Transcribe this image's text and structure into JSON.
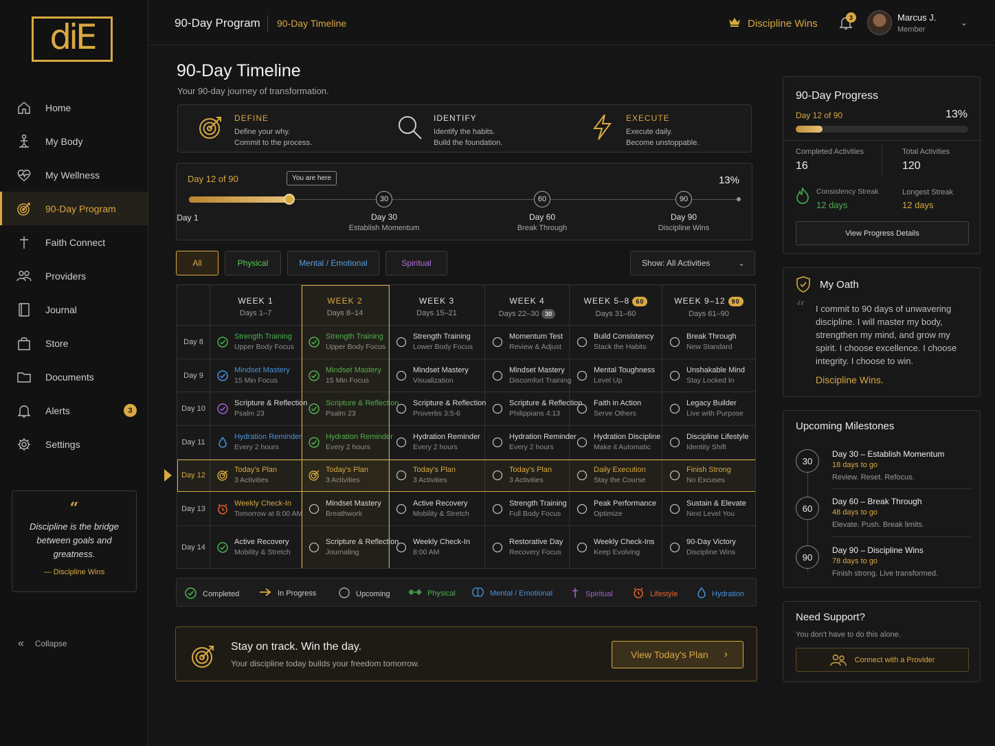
{
  "logo": {
    "text": "diE"
  },
  "sidebar": {
    "items": [
      {
        "label": "Home",
        "icon": "home-icon"
      },
      {
        "label": "My Body",
        "icon": "body-icon"
      },
      {
        "label": "My Wellness",
        "icon": "heart-pulse-icon"
      },
      {
        "label": "90-Day Program",
        "icon": "target-icon"
      },
      {
        "label": "Faith Connect",
        "icon": "cross-icon"
      },
      {
        "label": "Providers",
        "icon": "people-icon"
      },
      {
        "label": "Journal",
        "icon": "journal-icon"
      },
      {
        "label": "Store",
        "icon": "bag-icon"
      },
      {
        "label": "Documents",
        "icon": "folder-icon"
      },
      {
        "label": "Alerts",
        "icon": "bell-icon",
        "badge": "3"
      },
      {
        "label": "Settings",
        "icon": "gear-icon"
      }
    ],
    "quote": {
      "mark": "“",
      "text": "Discipline is the bridge between goals and greatness.",
      "author": "— Discipline Wins"
    },
    "collapse": "Collapse"
  },
  "header": {
    "crumb1": "90-Day Program",
    "crumb2": "90-Day Timeline",
    "wins": "Discipline Wins",
    "bell_badge": "3",
    "user_name": "Marcus J.",
    "user_role": "Member"
  },
  "page": {
    "title": "90-Day Timeline",
    "subtitle": "Your 90-day journey of transformation."
  },
  "die": [
    {
      "h": "DEFINE",
      "l1": "Define your why.",
      "l2": "Commit to the process."
    },
    {
      "h": "IDENTIFY",
      "l1": "Identify the habits.",
      "l2": "Build the foundation."
    },
    {
      "h": "EXECUTE",
      "l1": "Execute daily.",
      "l2": "Become unstoppable."
    }
  ],
  "track": {
    "day": "Day 12 of 90",
    "pct": "13%",
    "progress": 0.13,
    "tooltip": "You are here",
    "start": "Day 1",
    "milestones": [
      {
        "num": "30",
        "day": "Day 30",
        "name": "Establish Momentum"
      },
      {
        "num": "60",
        "day": "Day 60",
        "name": "Break Through"
      },
      {
        "num": "90",
        "day": "Day 90",
        "name": "Discipline Wins"
      }
    ]
  },
  "filters": {
    "all": "All",
    "physical": "Physical",
    "mental": "Mental / Emotional",
    "spiritual": "Spiritual",
    "show": "Show: All Activities"
  },
  "grid": {
    "weeks": [
      {
        "w": "WEEK 1",
        "d": "Days 1–7"
      },
      {
        "w": "WEEK 2",
        "d": "Days 8–14"
      },
      {
        "w": "WEEK 3",
        "d": "Days 15–21"
      },
      {
        "w": "WEEK 4",
        "d": "Days 22–30",
        "pill": "30"
      },
      {
        "w": "WEEK 5–8",
        "d": "Days 31–60",
        "pill": "60"
      },
      {
        "w": "WEEK 9–12",
        "d": "Days 61–90",
        "pill": "90"
      }
    ],
    "days": [
      "Day 8",
      "Day 9",
      "Day 10",
      "Day 11",
      "Day 12",
      "Day 13",
      "Day 14"
    ],
    "rows": [
      [
        {
          "t": "Strength Training",
          "s": "Upper Body Focus"
        },
        {
          "t": "Strength Training",
          "s": "Upper Body Focus"
        },
        {
          "t": "Strength Training",
          "s": "Lower Body Focus"
        },
        {
          "t": "Momentum Test",
          "s": "Review & Adjust"
        },
        {
          "t": "Build Consistency",
          "s": "Stack the Habits"
        },
        {
          "t": "Break Through",
          "s": "New Standard"
        }
      ],
      [
        {
          "t": "Mindset Mastery",
          "s": "15 Min Focus"
        },
        {
          "t": "Mindset Mastery",
          "s": "15 Min Focus"
        },
        {
          "t": "Mindset Mastery",
          "s": "Visualization"
        },
        {
          "t": "Mindset Mastery",
          "s": "Discomfort Training"
        },
        {
          "t": "Mental Toughness",
          "s": "Level Up"
        },
        {
          "t": "Unshakable Mind",
          "s": "Stay Locked In"
        }
      ],
      [
        {
          "t": "Scripture & Reflection",
          "s": "Psalm 23"
        },
        {
          "t": "Scripture & Reflection",
          "s": "Psalm 23"
        },
        {
          "t": "Scripture & Reflection",
          "s": "Proverbs 3:5-6"
        },
        {
          "t": "Scripture & Reflection",
          "s": "Philippians 4:13"
        },
        {
          "t": "Faith in Action",
          "s": "Serve Others"
        },
        {
          "t": "Legacy Builder",
          "s": "Live with Purpose"
        }
      ],
      [
        {
          "t": "Hydration Reminder",
          "s": "Every 2 hours"
        },
        {
          "t": "Hydration Reminder",
          "s": "Every 2 hours"
        },
        {
          "t": "Hydration Reminder",
          "s": "Every 2 hours"
        },
        {
          "t": "Hydration Reminder",
          "s": "Every 2 hours"
        },
        {
          "t": "Hydration Discipline",
          "s": "Make it Automatic"
        },
        {
          "t": "Discipline Lifestyle",
          "s": "Identity Shift"
        }
      ],
      [
        {
          "t": "Today's Plan",
          "s": "3 Activities"
        },
        {
          "t": "Today's Plan",
          "s": "3 Activities"
        },
        {
          "t": "Today's Plan",
          "s": "3 Activities"
        },
        {
          "t": "Today's Plan",
          "s": "3 Activities"
        },
        {
          "t": "Daily Execution",
          "s": "Stay the Course"
        },
        {
          "t": "Finish Strong",
          "s": "No Excuses"
        }
      ],
      [
        {
          "t": "Weekly Check-In",
          "s": "Tomorrow at 8:00 AM"
        },
        {
          "t": "Mindset Mastery",
          "s": "Breathwork"
        },
        {
          "t": "Active Recovery",
          "s": "Mobility & Stretch"
        },
        {
          "t": "Strength Training",
          "s": "Full Body Focus"
        },
        {
          "t": "Peak Performance",
          "s": "Optimize"
        },
        {
          "t": "Sustain & Elevate",
          "s": "Next Level You"
        }
      ],
      [
        {
          "t": "Active Recovery",
          "s": "Mobility & Stretch"
        },
        {
          "t": "Scripture & Reflection",
          "s": "Journaling"
        },
        {
          "t": "Weekly Check-In",
          "s": "8:00 AM"
        },
        {
          "t": "Restorative Day",
          "s": "Recovery Focus"
        },
        {
          "t": "Weekly Check-Ins",
          "s": "Keep Evolving"
        },
        {
          "t": "90-Day Victory",
          "s": "Discipline Wins"
        }
      ]
    ]
  },
  "legend": [
    {
      "label": "Completed",
      "icon": "check-circle-icon",
      "color": "#4caf50"
    },
    {
      "label": "In Progress",
      "icon": "arrow-right-icon",
      "color": "#d9a942"
    },
    {
      "label": "Upcoming",
      "icon": "circle-icon",
      "color": "#aaaaaa"
    },
    {
      "label": "Physical",
      "icon": "dumbbell-icon",
      "color": "#4caf50"
    },
    {
      "label": "Mental / Emotional",
      "icon": "brain-icon",
      "color": "#4a90d9"
    },
    {
      "label": "Spiritual",
      "icon": "cross-icon",
      "color": "#a060d0"
    },
    {
      "label": "Lifestyle",
      "icon": "alarm-icon",
      "color": "#e8632a"
    },
    {
      "label": "Hydration",
      "icon": "drop-icon",
      "color": "#4a90d9"
    }
  ],
  "cta": {
    "title": "Stay on track. Win the day.",
    "sub": "Your discipline today builds your freedom tomorrow.",
    "button": "View Today's Plan"
  },
  "progress": {
    "title": "90-Day Progress",
    "day": "Day 12 of 90",
    "pct": "13%",
    "fill": 0.13,
    "completed_label": "Completed Activities",
    "completed": "16",
    "total_label": "Total Activities",
    "total": "120",
    "streak_label": "Consistency Streak",
    "streak": "12 days",
    "longest_label": "Longest Streak",
    "longest": "12 days",
    "button": "View Progress Details"
  },
  "oath": {
    "title": "My Oath",
    "mark": "“",
    "text": "I commit to 90 days of unwavering discipline. I will master my body, strengthen my mind, and grow my spirit. I choose excellence. I choose integrity. I choose to win.",
    "sig": "Discipline Wins."
  },
  "milestones": {
    "title": "Upcoming Milestones",
    "items": [
      {
        "num": "30",
        "t": "Day 30 – Establish Momentum",
        "d": "18 days to go",
        "s": "Review. Reset. Refocus."
      },
      {
        "num": "60",
        "t": "Day 60 – Break Through",
        "d": "48 days to go",
        "s": "Elevate. Push. Break limits."
      },
      {
        "num": "90",
        "t": "Day 90 – Discipline Wins",
        "d": "78 days to go",
        "s": "Finish strong. Live transformed."
      }
    ]
  },
  "support": {
    "title": "Need Support?",
    "sub": "You don't have to do this alone.",
    "button": "Connect with a Provider"
  }
}
